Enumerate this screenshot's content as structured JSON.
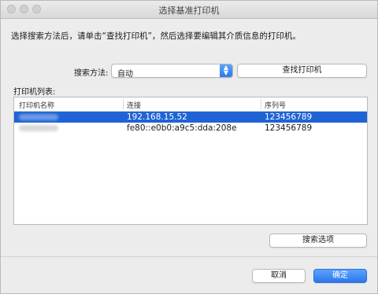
{
  "window": {
    "title": "选择基准打印机"
  },
  "instruction": "选择搜索方法后，请单击“查找打印机”，然后选择要编辑其介质信息的打印机。",
  "search": {
    "label": "搜索方法:",
    "selected": "自动",
    "find_button": "查找打印机"
  },
  "printer_list": {
    "label": "打印机列表:",
    "columns": [
      "打印机名称",
      "连接",
      "序列号"
    ],
    "rows": [
      {
        "name": "",
        "connection": "192.168.15.52",
        "serial": "123456789",
        "selected": true
      },
      {
        "name": "",
        "connection": "fe80::e0b0:a9c5:dda:208e",
        "serial": "123456789",
        "selected": false
      }
    ]
  },
  "search_options_button": "搜索选项",
  "footer": {
    "cancel": "取消",
    "ok": "确定"
  },
  "colors": {
    "accent": "#2d77e8",
    "selection": "#1f63d6"
  }
}
